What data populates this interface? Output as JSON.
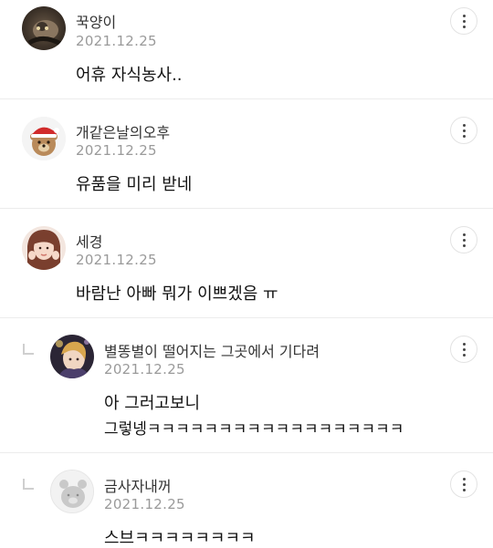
{
  "comments": [
    {
      "author": "꾹양이",
      "date": "2021.12.25",
      "lines": [
        "어휴 자식농사.."
      ],
      "avatar_icon": "cat-photo-avatar",
      "is_reply": false
    },
    {
      "author": "개같은날의오후",
      "date": "2021.12.25",
      "lines": [
        "유품을 미리 받네"
      ],
      "avatar_icon": "santa-bear-avatar",
      "is_reply": false
    },
    {
      "author": "세경",
      "date": "2021.12.25",
      "lines": [
        "바람난 아빠 뭐가 이쁘겠음 ㅠ"
      ],
      "avatar_icon": "woman-photo-avatar",
      "is_reply": false
    },
    {
      "author": "별똥별이 떨어지는 그곳에서 기다려",
      "date": "2021.12.25",
      "lines": [
        "아 그러고보니",
        "그렇넹ㅋㅋㅋㅋㅋㅋㅋㅋㅋㅋㅋㅋㅋㅋㅋㅋㅋㅋ"
      ],
      "avatar_icon": "anime-photo-avatar",
      "is_reply": true
    },
    {
      "author": "금사자내꺼",
      "date": "2021.12.25",
      "lines": [
        "스브ㅋㅋㅋㅋㅋㅋㅋㅋ"
      ],
      "avatar_icon": "default-bear-avatar",
      "is_reply": true
    }
  ],
  "colors": {
    "date": "#9a9a9a",
    "divider": "#ececec",
    "text": "#111111"
  },
  "icons": {
    "more": "more-vertical-icon",
    "reply": "reply-arrow-icon"
  }
}
